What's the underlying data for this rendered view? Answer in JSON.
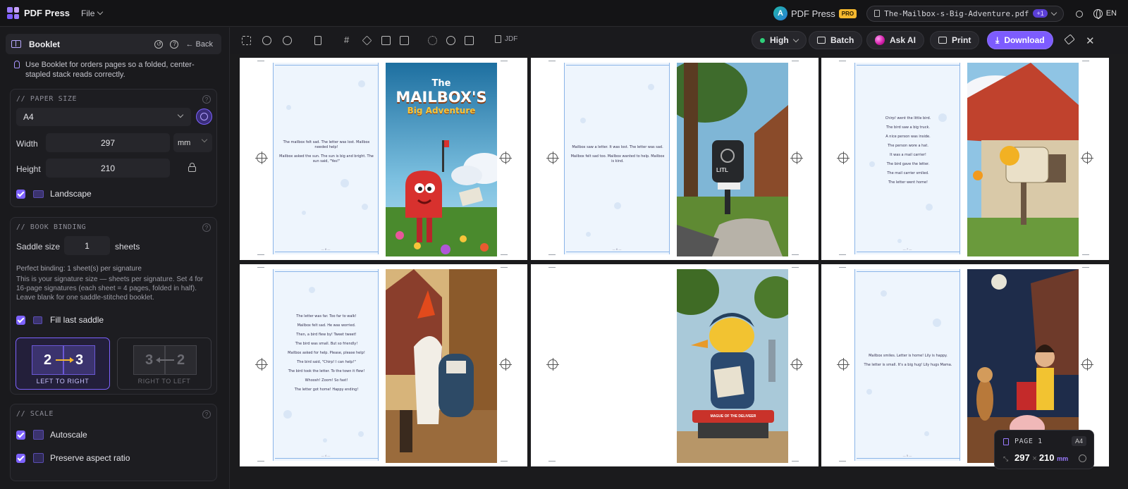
{
  "app": {
    "name": "PDF Press",
    "file_menu": "File"
  },
  "topbar": {
    "avatar_letter": "A",
    "brand": "PDF Press",
    "badge": "PRO",
    "filename": "The-Mailbox-s-Big-Adventure.pdf",
    "file_count": "+1",
    "language": "EN"
  },
  "sidebar": {
    "title": "Booklet",
    "back_label": "Back",
    "hint": "Use Booklet for orders pages so a folded, center-stapled stack reads correctly.",
    "paper": {
      "section": "// PAPER SIZE",
      "size_value": "A4",
      "width_label": "Width",
      "width_value": "297",
      "unit": "mm",
      "height_label": "Height",
      "height_value": "210",
      "landscape_label": "Landscape"
    },
    "binding": {
      "section": "// BOOK BINDING",
      "saddle_label": "Saddle size",
      "saddle_value": "1",
      "saddle_unit": "sheets",
      "perfect_info": "Perfect binding: 1 sheet(s) per signature",
      "explain": "This is your signature size — sheets per signature. Set 4 for 16-page signatures (each sheet = 4 pages, folded in half). Leave blank for one saddle-stitched booklet.",
      "fill_label": "Fill last saddle",
      "ltr": {
        "a": "2",
        "b": "3",
        "label": "LEFT TO RIGHT"
      },
      "rtl": {
        "a": "3",
        "b": "2",
        "label": "RIGHT TO LEFT"
      }
    },
    "scale": {
      "section": "// SCALE",
      "autoscale_label": "Autoscale",
      "aspect_label": "Preserve aspect ratio"
    }
  },
  "toolbar": {
    "jdf_label": "JDF",
    "quality": "High",
    "batch": "Batch",
    "ask_ai": "Ask AI",
    "print": "Print",
    "download": "Download"
  },
  "sheets": [
    {
      "left_text": [
        "The mailbox felt sad. The letter was lost. Mailbox needed help!",
        "Mailbox asked the sun. The sun is big and bright. The sun said, \"Yes!\""
      ],
      "left_num": "— 8 —",
      "right_title_1": "The",
      "right_title_2": "MAILBOX'S",
      "right_title_3": "Big Adventure"
    },
    {
      "left_text": [
        "Mailbox saw a letter. It was lost. The letter was sad.",
        "Mailbox felt sad too. Mailbox wanted to help. Mailbox is kind."
      ],
      "left_num": "— 6 —",
      "right_sign": "LITL"
    },
    {
      "left_text": [
        "Chirp! went the little bird.",
        "The bird saw a big truck.",
        "A nice person was inside.",
        "The person wore a hat.",
        "It was a mail carrier!",
        "The bird gave the letter.",
        "The mail carrier smiled.",
        "The letter went home!"
      ],
      "left_num": "— 7 —"
    },
    {
      "left_text": [
        "The letter was far. Too far to walk!",
        "Mailbox felt sad. He was worried.",
        "Then, a bird flew by! Tweet tweet!",
        "The bird was small. But so friendly!",
        "Mailbox asked for help. Please, please help!",
        "The bird said, \"Chirp! I can help!\"",
        "The bird took the letter. To the town it flew!",
        "Whoosh! Zoom! So fast!",
        "The letter got home! Happy ending!"
      ],
      "left_num": "— 4 —"
    },
    {
      "left_text": [],
      "left_num": "",
      "right_sign": "MAGUE OF THE DELIVEER"
    },
    {
      "left_text": [
        "Mailbox smiles. Letter is home! Lily is happy.",
        "The letter is small. It's a big hug! Lily hugs Mama."
      ],
      "left_num": "— 5 —"
    }
  ],
  "page_info": {
    "label": "PAGE 1",
    "paper": "A4",
    "width": "297",
    "height": "210",
    "unit": "mm"
  },
  "colors": {
    "accent": "#7d5cff",
    "pro_badge": "#f5b82e",
    "page_tint": "#eef5fd"
  }
}
